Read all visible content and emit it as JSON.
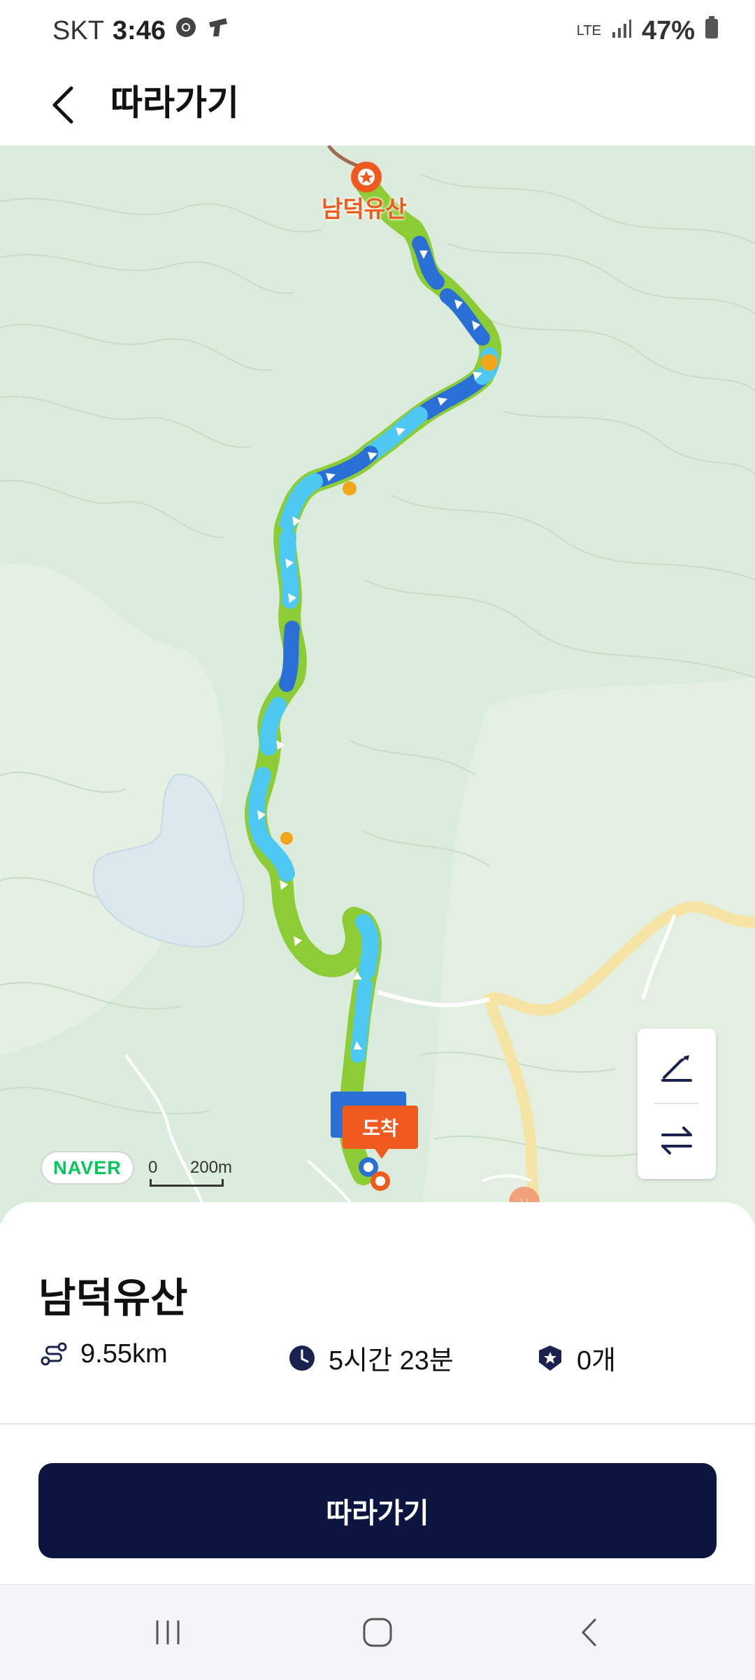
{
  "status_bar": {
    "carrier": "SKT",
    "time": "3:46",
    "network": "LTE",
    "battery": "47%"
  },
  "app_bar": {
    "title": "따라가기"
  },
  "map": {
    "peak_label": "남덕유산",
    "arrival_label": "도착",
    "provider_logo": "NAVER",
    "scale_zero": "0",
    "scale_distance": "200m"
  },
  "sheet": {
    "title": "남덕유산",
    "distance": "9.55km",
    "duration": "5시간 23분",
    "stamp_count": "0개",
    "follow_button_label": "따라가기"
  },
  "colors": {
    "primary_dark": "#0c1540",
    "accent_orange": "#ef5a1e",
    "route_green": "#8ccc35",
    "route_cyan": "#4cc8f2",
    "route_blue": "#2a6fd6",
    "naver_green": "#03c75a"
  }
}
